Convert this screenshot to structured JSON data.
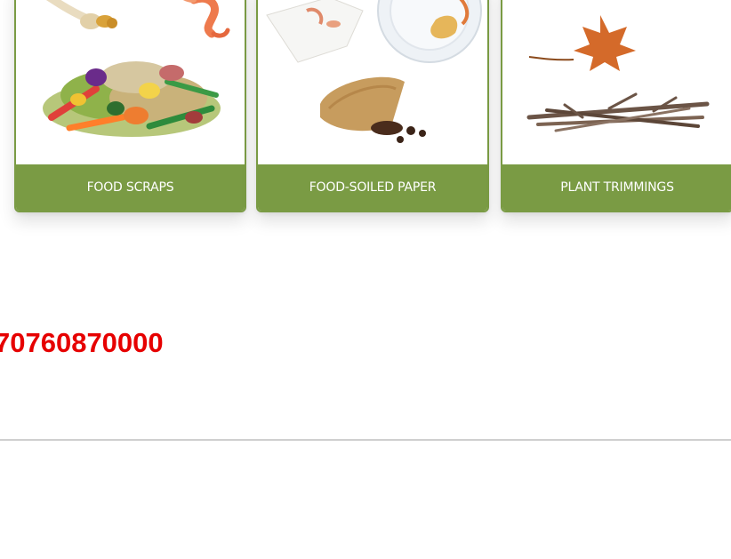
{
  "cards": [
    {
      "label": "FOOD SCRAPS",
      "image_icon": "food-scraps-illustration"
    },
    {
      "label": "FOOD-SOILED PAPER",
      "image_icon": "food-soiled-paper-illustration"
    },
    {
      "label": "PLANT TRIMMINGS",
      "image_icon": "plant-trimmings-illustration"
    }
  ],
  "phone_text": "70760870000",
  "colors": {
    "card_accent": "#7a9b44",
    "phone_text": "#e60000",
    "divider": "#cfcfcf"
  }
}
